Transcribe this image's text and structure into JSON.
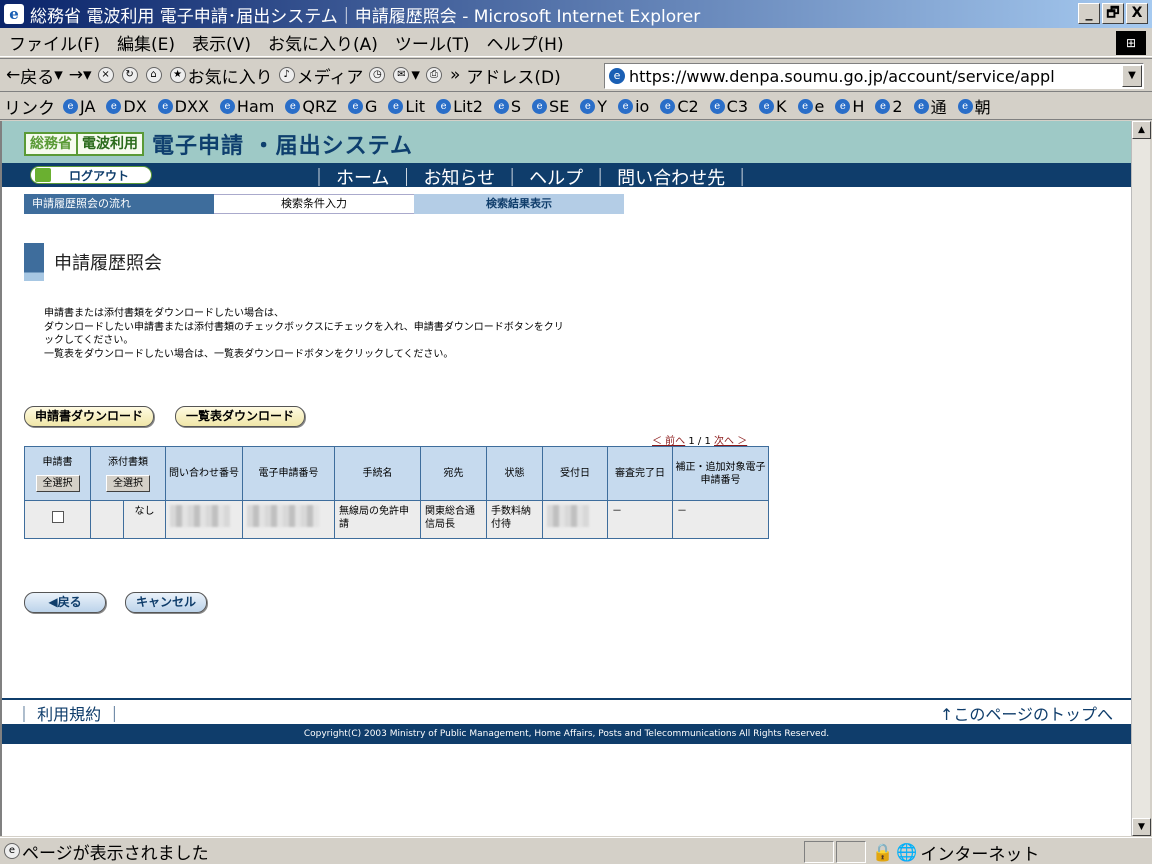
{
  "window": {
    "title": "総務省 電波利用 電子申請･届出システム｜申請履歴照会 - Microsoft Internet Explorer",
    "min": "_",
    "max": "🗗",
    "close": "X"
  },
  "menubar": {
    "items": [
      "ファイル(F)",
      "編集(E)",
      "表示(V)",
      "お気に入り(A)",
      "ツール(T)",
      "ヘルプ(H)"
    ]
  },
  "toolbar": {
    "back": "戻る",
    "favorites": "お気に入り",
    "media": "メディア",
    "address_label": "アドレス(D)",
    "address_value": "https://www.denpa.soumu.go.jp/account/service/appl"
  },
  "linksbar": {
    "label": "リンク",
    "items": [
      "JA",
      "DX",
      "DXX",
      "Ham",
      "QRZ",
      "G",
      "Lit",
      "Lit2",
      "S",
      "SE",
      "Y",
      "io",
      "C2",
      "C3",
      "K",
      "e",
      "H",
      "2",
      "通",
      "朝"
    ]
  },
  "site": {
    "logo_ministry": "総務省",
    "logo_denpa": "電波利用",
    "logo_system": "電子申請 ・届出システム",
    "logout": "ログアウト",
    "nav": [
      "ホーム",
      "お知らせ",
      "ヘルプ",
      "問い合わせ先"
    ],
    "nav_sep": "｜"
  },
  "steps": {
    "head": "申請履歴照会の流れ",
    "step1": "検索条件入力",
    "step2": "検索結果表示"
  },
  "heading": "申請履歴照会",
  "instructions": [
    "申請書または添付書類をダウンロードしたい場合は、",
    "ダウンロードしたい申請書または添付書類のチェックボックスにチェックを入れ、申請書ダウンロードボタンをクリ",
    "ックしてください。",
    "一覧表をダウンロードしたい場合は、一覧表ダウンロードボタンをクリックしてください。"
  ],
  "buttons": {
    "download_application": "申請書ダウンロード",
    "download_list": "一覧表ダウンロード",
    "back": "◀戻る",
    "cancel": "キャンセル",
    "select_all": "全選択"
  },
  "pager": {
    "prev": "＜ 前へ",
    "page": "1 / 1",
    "next": "次へ ＞"
  },
  "table": {
    "headers": {
      "application": "申請書",
      "attachment": "添付書類",
      "inquiry_no": "問い合わせ番号",
      "e_app_no": "電子申請番号",
      "procedure": "手続名",
      "destination": "宛先",
      "status": "状態",
      "received": "受付日",
      "review_done": "審査完了日",
      "correction": "補正・追加対象電子申請番号"
    },
    "rows": [
      {
        "attachment": "なし",
        "procedure": "無線局の免許申請",
        "destination": "関東総合通信局長",
        "status": "手数料納付待",
        "review_done": "－",
        "correction": "－"
      }
    ]
  },
  "footer": {
    "terms": "利用規約",
    "to_top": "↑このページのトップへ",
    "copyright": "Copyright(C) 2003 Ministry of Public Management, Home Affairs, Posts and Telecommunications All Rights Reserved."
  },
  "statusbar": {
    "message": "ページが表示されました",
    "zone": "インターネット"
  }
}
